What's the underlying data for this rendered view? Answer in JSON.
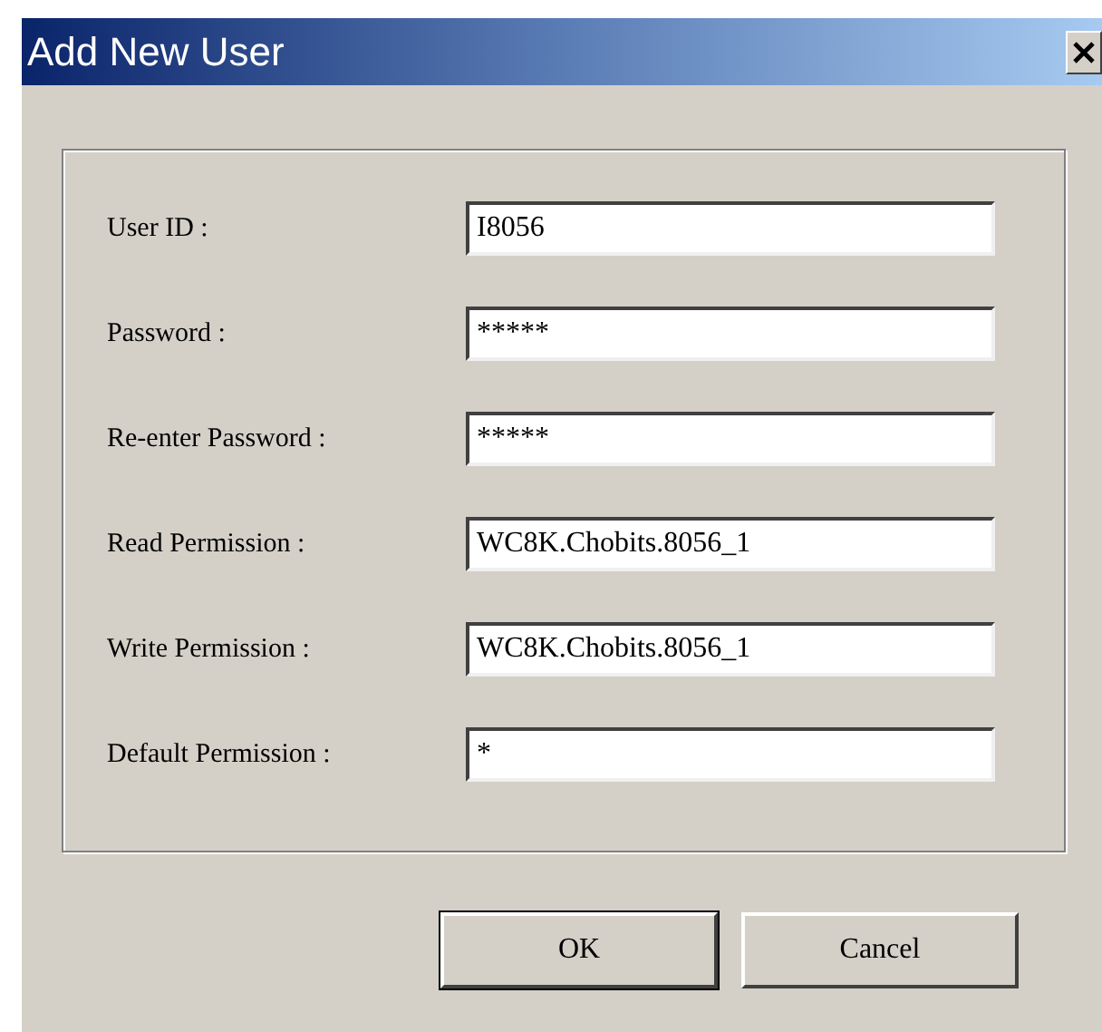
{
  "window": {
    "title": "Add New User"
  },
  "fields": [
    {
      "label": "User ID :",
      "value": "I8056"
    },
    {
      "label": "Password :",
      "value": "*****"
    },
    {
      "label": "Re-enter Password :",
      "value": "*****"
    },
    {
      "label": "Read Permission :",
      "value": "WC8K.Chobits.8056_1"
    },
    {
      "label": "Write Permission :",
      "value": "WC8K.Chobits.8056_1"
    },
    {
      "label": "Default Permission :",
      "value": "*"
    }
  ],
  "buttons": [
    {
      "label": "OK",
      "default": true
    },
    {
      "label": "Cancel",
      "default": false
    }
  ]
}
